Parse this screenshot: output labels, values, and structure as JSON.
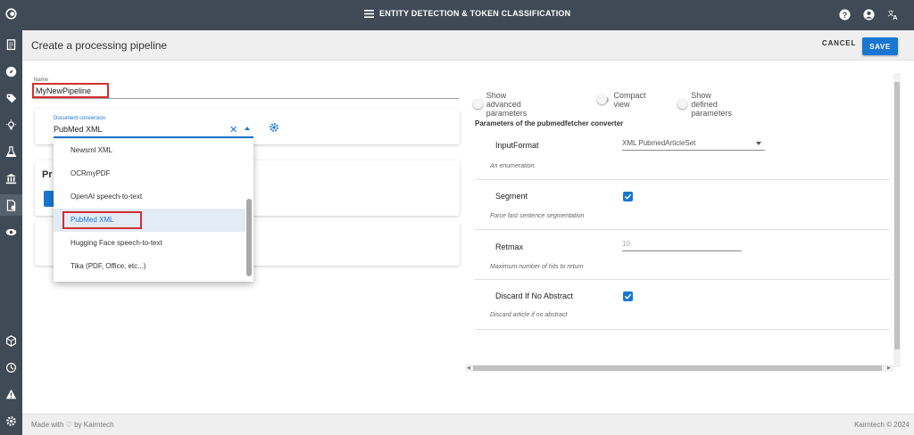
{
  "header": {
    "title": "ENTITY DETECTION & TOKEN CLASSIFICATION",
    "icons": [
      "menu-icon",
      "help-icon",
      "account-icon",
      "translate-icon"
    ]
  },
  "sidebar": {
    "items": [
      "logo-icon",
      "documents-icon",
      "explore-icon",
      "tags-icon",
      "lightbulb-icon",
      "lab-flask-icon",
      "bank-icon",
      "pipeline-icon",
      "eye-icon",
      "cube-icon",
      "history-icon",
      "warning-icon",
      "settings-icon"
    ]
  },
  "subheader": {
    "title": "Create a processing pipeline",
    "cancel_label": "CANCEL",
    "save_label": "SAVE"
  },
  "form": {
    "name_label": "Name",
    "name_value": "MyNewPipeline",
    "conversion_label": "Document conversion",
    "conversion_value": "PubMed XML",
    "processors_title": "Pr"
  },
  "dropdown": {
    "options": [
      "Newsml XML",
      "OCRmyPDF",
      "OpenAI speech-to-text",
      "PubMed XML",
      "Hugging Face speech-to-text",
      "Tika (PDF, Office, etc...)"
    ],
    "selected_index": 3
  },
  "toggles": {
    "advanced": "Show advanced parameters",
    "compact": "Compact view",
    "defined": "Show defined parameters"
  },
  "parameters": {
    "title": "Parameters of the pubmedfetcher converter",
    "input_format": {
      "name": "InputFormat",
      "value": "XML PubmedArticleSet",
      "desc": "An enumeration."
    },
    "segment": {
      "name": "Segment",
      "checked": true,
      "desc": "Force fast sentence segmentation"
    },
    "retmax": {
      "name": "Retmax",
      "value": "10",
      "desc": "Maximum number of hits to return"
    },
    "discard": {
      "name": "Discard If No Abstract",
      "checked": true,
      "desc": "Discard article if no abstract"
    }
  },
  "footer": {
    "left": "Made with ♡ by Kairntech",
    "right": "Kairntech © 2024"
  },
  "colors": {
    "accent": "#1976d2",
    "sidebar": "#3f4a56",
    "highlight": "#d32f2f"
  }
}
